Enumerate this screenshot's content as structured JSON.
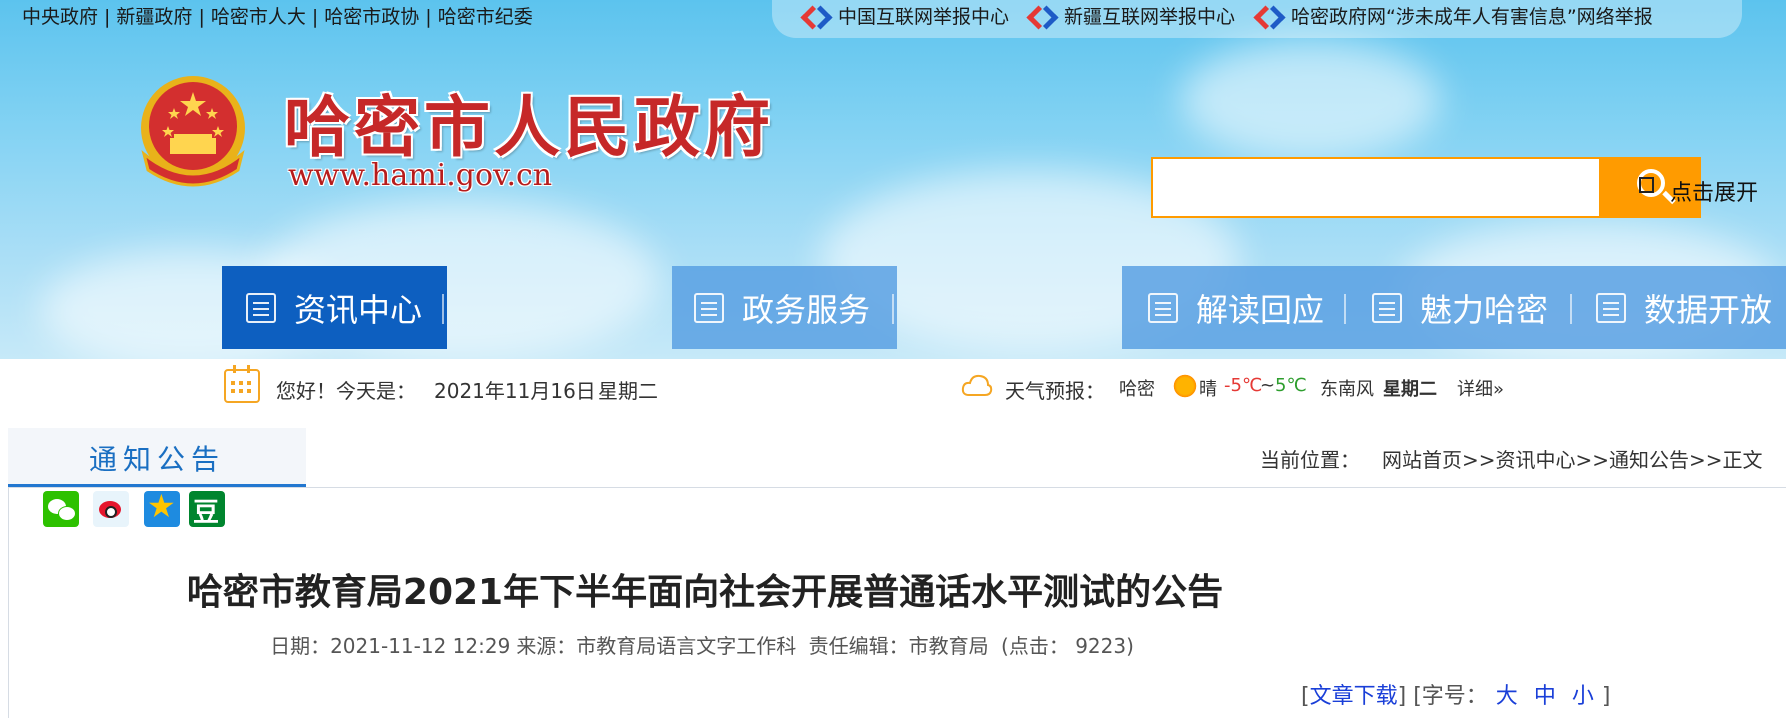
{
  "top_links": [
    "中央政府",
    "新疆政府",
    "哈密市人大",
    "哈密市政协",
    "哈密市纪委"
  ],
  "top_links_separator": "|",
  "report_links": [
    "中国互联网举报中心",
    "新疆互联网举报中心",
    "哈密政府网“涉未成年人有害信息”网络举报"
  ],
  "site": {
    "name": "哈密市人民政府",
    "url": "www.hami.gov.cn"
  },
  "search": {
    "placeholder": "",
    "expand_label": "点击展开"
  },
  "nav": {
    "items": [
      "资讯中心",
      "政务服务",
      "解读回应",
      "魅力哈密",
      "数据开放"
    ],
    "active": "资讯中心"
  },
  "date_bar": {
    "greeting": "您好！今天是：",
    "date": "2021年11月16日",
    "weekday": "星期二"
  },
  "weather": {
    "label": "天气预报：",
    "city": "哈密",
    "condition": "晴",
    "temp_low": "-5℃",
    "tilde": "~",
    "temp_high": "5℃",
    "wind": "东南风",
    "day": "星期二",
    "detail": "详细»"
  },
  "section": {
    "title": "通知公告"
  },
  "breadcrumb": {
    "label": "当前位置：",
    "path": "网站首页>>资讯中心>>通知公告>>正文"
  },
  "share_icons": [
    "wechat-icon",
    "weibo-icon",
    "qzone-icon",
    "douban-icon"
  ],
  "article": {
    "title": "哈密市教育局2021年下半年面向社会开展普通话水平测试的公告",
    "date": "日期：2021-11-12 12:29",
    "source": "来源：市教育局语言文字工作科",
    "editor": "责任编辑：市教育局",
    "clicks": "(点击： 9223)",
    "download_prefix": "[",
    "download": "文章下载",
    "download_suffix": "]",
    "font_size_prefix": "[字号：",
    "font_large": "大",
    "font_medium": "中",
    "font_small": "小",
    "font_size_suffix": "]"
  },
  "colors": {
    "accent_blue": "#0d5fc0",
    "search_orange": "#ff9b00",
    "title_red": "#c62828",
    "link_blue": "#1a3fd8"
  }
}
